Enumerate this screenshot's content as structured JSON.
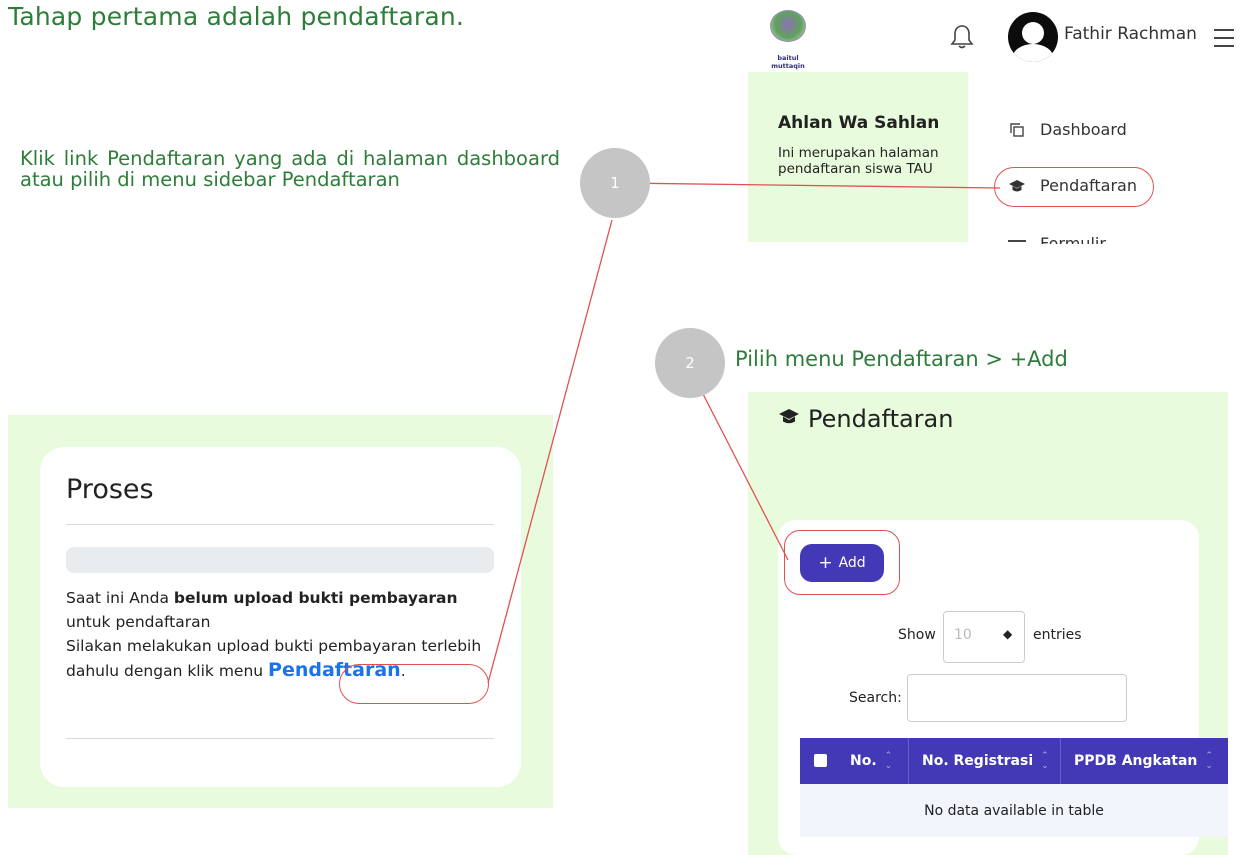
{
  "title": "Tahap pertama adalah pendaftaran.",
  "instruction1": "Klik link Pendaftaran yang ada di halaman dashboard atau pilih di menu sidebar Pendaftaran",
  "instruction2": "Pilih menu Pendaftaran > +Add",
  "steps": [
    "1",
    "2"
  ],
  "header": {
    "logo_caption": "baitul muttaqin",
    "logo_icon": "school-emblem",
    "user_name": "Fathir Rachman"
  },
  "welcome": {
    "heading": "Ahlan Wa Sahlan",
    "line1": "Ini merupakan halaman",
    "line2": "pendaftaran siswa TAU"
  },
  "sidebar": {
    "items": [
      {
        "label": "Dashboard",
        "icon": "copy-icon"
      },
      {
        "label": "Pendaftaran",
        "icon": "graduation-cap-icon"
      },
      {
        "label": "Formulir",
        "icon": "list-icon"
      }
    ]
  },
  "proses": {
    "title": "Proses",
    "text_a": "Saat ini Anda ",
    "text_bold": "belum upload bukti pembayaran",
    "text_b": " untuk pendaftaran",
    "text_c": "Silakan melakukan upload bukti pembayaran terlebih dahulu dengan klik menu ",
    "link": "Pendaftaran",
    "text_end": "."
  },
  "pendaftaran": {
    "title": "Pendaftaran",
    "add_label": "Add",
    "show_label": "Show",
    "entries_value": "10",
    "entries_label": "entries",
    "search_label": "Search:",
    "columns": [
      "No.",
      "No. Registrasi",
      "PPDB Angkatan"
    ],
    "empty_text": "No data available in table"
  },
  "colors": {
    "accent_green": "#2e7d3a",
    "panel_green": "#e8fbdc",
    "primary": "#4338b5",
    "link_blue": "#1a73e8",
    "highlight_red": "#e05252"
  }
}
